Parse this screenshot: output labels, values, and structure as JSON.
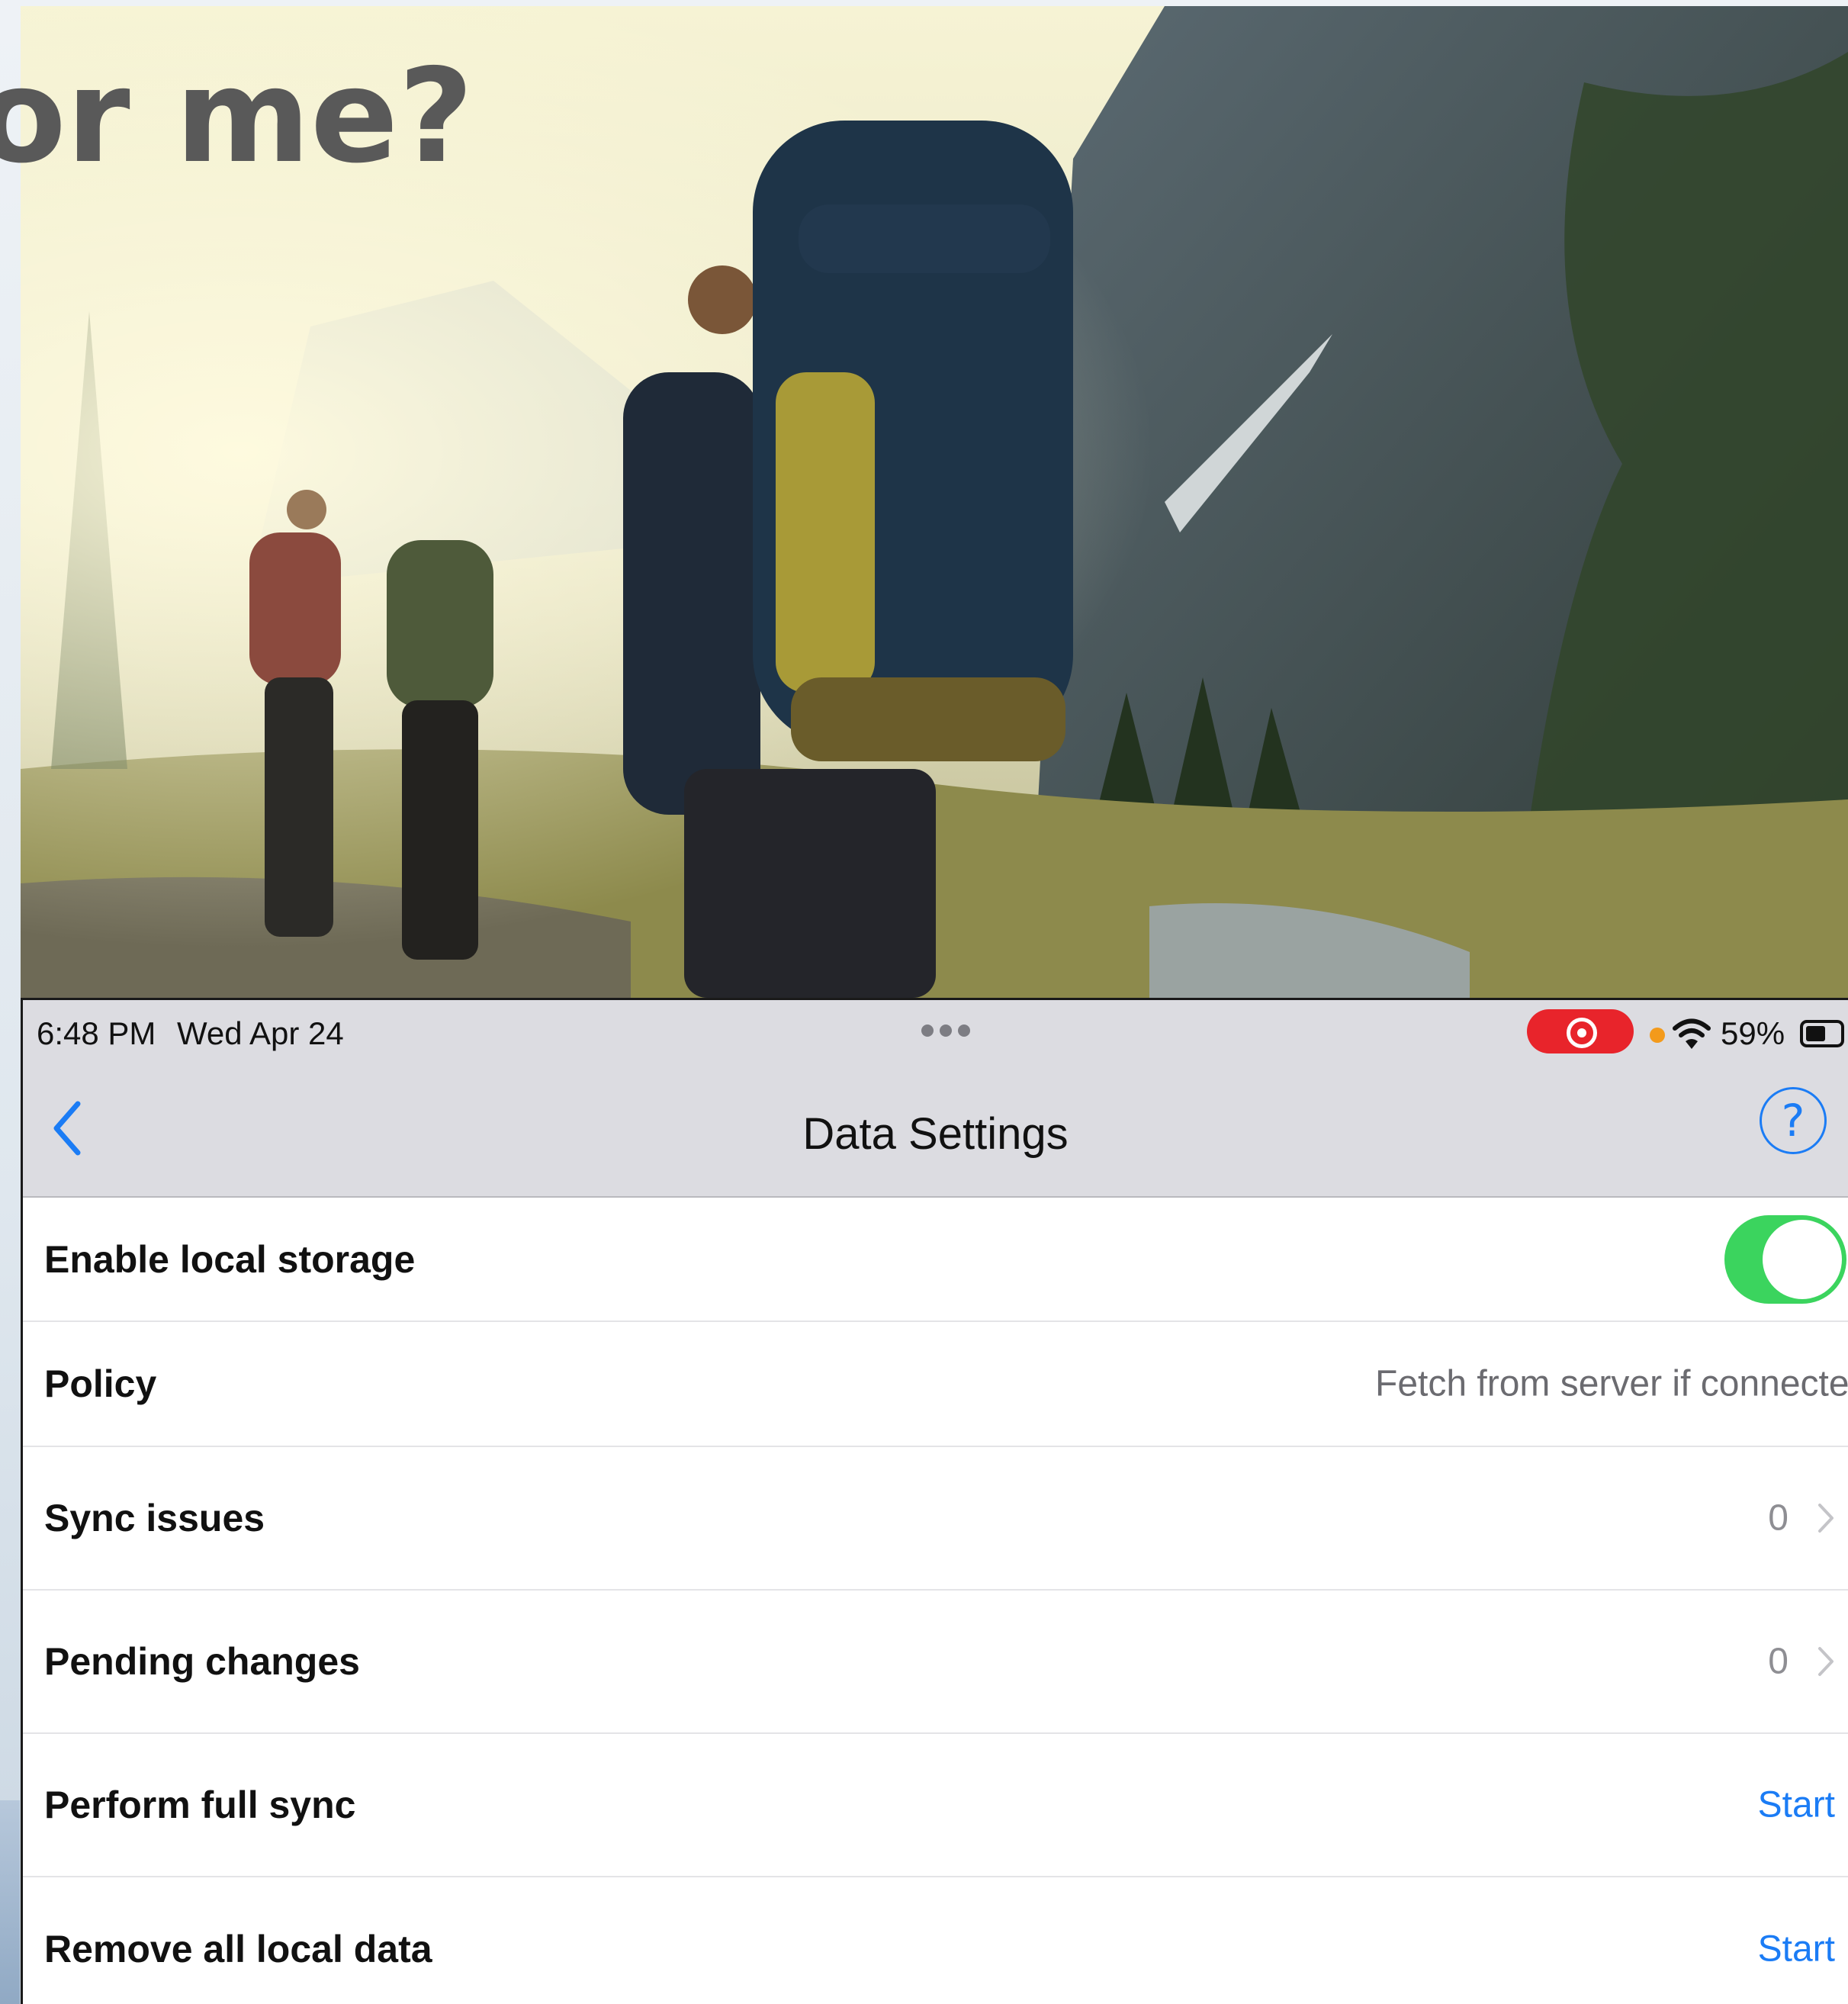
{
  "slide": {
    "title_fragment": "or me?"
  },
  "status_bar": {
    "time": "6:48 PM",
    "date": "Wed Apr 24",
    "battery_percent": "59%",
    "battery_level": 0.59
  },
  "nav": {
    "title": "Data Settings",
    "help_label": "?"
  },
  "settings": {
    "enable_local_storage": {
      "label": "Enable local storage",
      "enabled": true
    },
    "policy": {
      "label": "Policy",
      "value": "Fetch from server if connected"
    },
    "sync_issues": {
      "label": "Sync issues",
      "count": "0"
    },
    "pending_changes": {
      "label": "Pending changes",
      "count": "0"
    },
    "full_sync": {
      "label": "Perform full sync",
      "action": "Start"
    },
    "remove_local": {
      "label": "Remove all local data",
      "action": "Start"
    }
  },
  "colors": {
    "accent": "#1b7cf5",
    "toggle_on": "#3bd45e",
    "record": "#e8242b",
    "bar_bg": "#dcdce1"
  }
}
